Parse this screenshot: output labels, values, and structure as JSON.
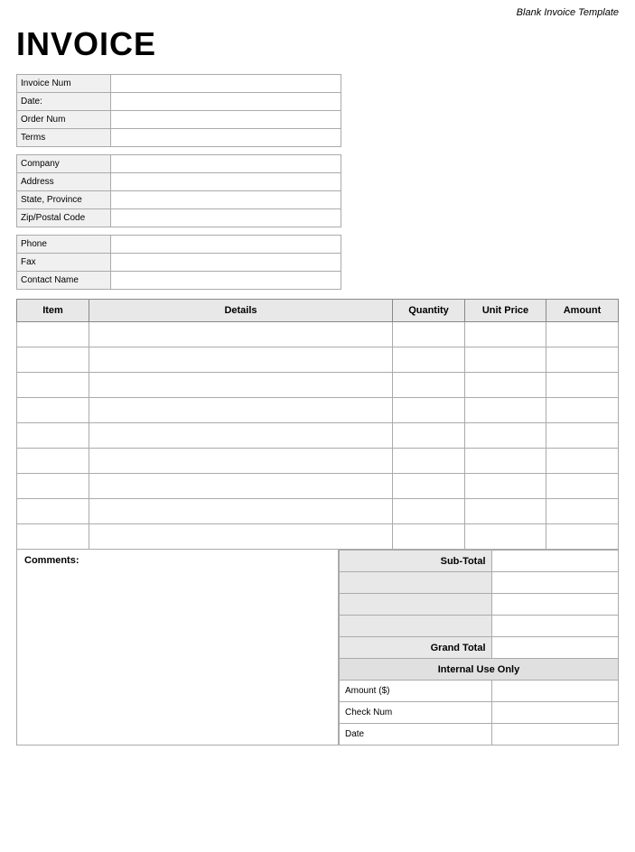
{
  "watermark": "Blank Invoice Template",
  "title": "INVOICE",
  "fields": {
    "invoiceNum": {
      "label": "Invoice Num",
      "value": ""
    },
    "date": {
      "label": "Date:",
      "value": ""
    },
    "orderNum": {
      "label": "Order Num",
      "value": ""
    },
    "terms": {
      "label": "Terms",
      "value": ""
    },
    "company": {
      "label": "Company",
      "value": ""
    },
    "address": {
      "label": "Address",
      "value": ""
    },
    "stateProvince": {
      "label": "State, Province",
      "value": ""
    },
    "zipPostalCode": {
      "label": "Zip/Postal Code",
      "value": ""
    },
    "phone": {
      "label": "Phone",
      "value": ""
    },
    "fax": {
      "label": "Fax",
      "value": ""
    },
    "contactName": {
      "label": "Contact Name",
      "value": ""
    }
  },
  "table": {
    "headers": {
      "item": "Item",
      "details": "Details",
      "quantity": "Quantity",
      "unitPrice": "Unit Price",
      "amount": "Amount"
    },
    "rows": 9
  },
  "comments": {
    "label": "Comments:"
  },
  "totals": {
    "subTotal": "Sub-Total",
    "grandTotal": "Grand Total",
    "internalUseOnly": "Internal Use Only",
    "amountS": "Amount ($)",
    "checkNum": "Check Num",
    "date": "Date",
    "extraRows": 3
  }
}
